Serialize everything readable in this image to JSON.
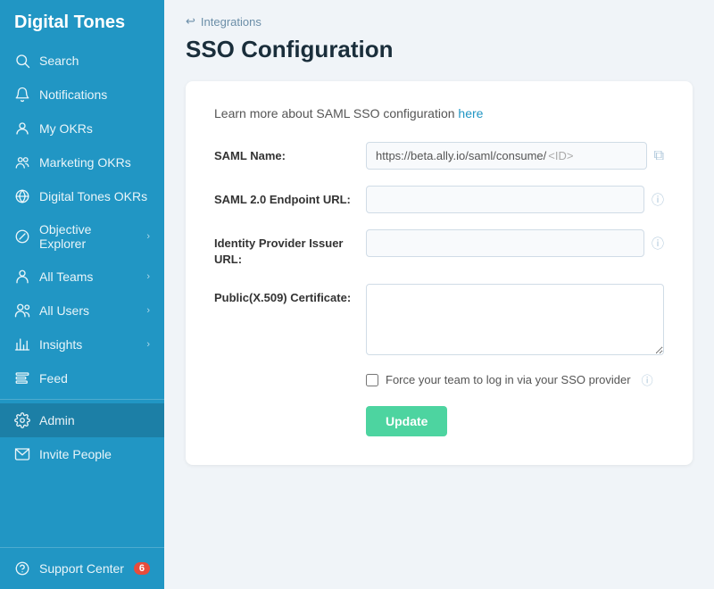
{
  "app": {
    "name": "Digital Tones"
  },
  "sidebar": {
    "items": [
      {
        "id": "search",
        "label": "Search",
        "icon": "search"
      },
      {
        "id": "notifications",
        "label": "Notifications",
        "icon": "bell"
      },
      {
        "id": "my-okrs",
        "label": "My OKRs",
        "icon": "user-circle"
      },
      {
        "id": "marketing-okrs",
        "label": "Marketing OKRs",
        "icon": "team"
      },
      {
        "id": "digital-tones-okrs",
        "label": "Digital Tones OKRs",
        "icon": "globe"
      },
      {
        "id": "objective-explorer",
        "label": "Objective Explorer",
        "icon": "compass",
        "chevron": true
      },
      {
        "id": "all-teams",
        "label": "All Teams",
        "icon": "users-group",
        "chevron": true
      },
      {
        "id": "all-users",
        "label": "All Users",
        "icon": "users",
        "chevron": true
      },
      {
        "id": "insights",
        "label": "Insights",
        "icon": "chart",
        "chevron": true
      },
      {
        "id": "feed",
        "label": "Feed",
        "icon": "feed"
      }
    ],
    "bottom_items": [
      {
        "id": "admin",
        "label": "Admin",
        "icon": "gear",
        "active": true
      },
      {
        "id": "invite-people",
        "label": "Invite People",
        "icon": "envelope"
      }
    ],
    "support": {
      "label": "Support Center",
      "icon": "help-circle",
      "badge": "6"
    }
  },
  "breadcrumb": {
    "arrow": "↩",
    "label": "Integrations"
  },
  "page": {
    "title": "SSO Configuration"
  },
  "form": {
    "learn_more_prefix": "Learn more about SAML SSO configuration ",
    "learn_more_link": "here",
    "saml_name_label": "SAML Name:",
    "saml_name_value": "https://beta.ally.io/saml/consume/",
    "saml_name_placeholder": " <ID>",
    "saml_endpoint_label": "SAML 2.0 Endpoint URL:",
    "saml_endpoint_value": "",
    "identity_provider_label": "Identity Provider Issuer URL:",
    "identity_provider_value": "",
    "certificate_label": "Public(X.509) Certificate:",
    "certificate_value": "",
    "checkbox_label": "Force your team to log in via your SSO provider",
    "update_button": "Update"
  }
}
